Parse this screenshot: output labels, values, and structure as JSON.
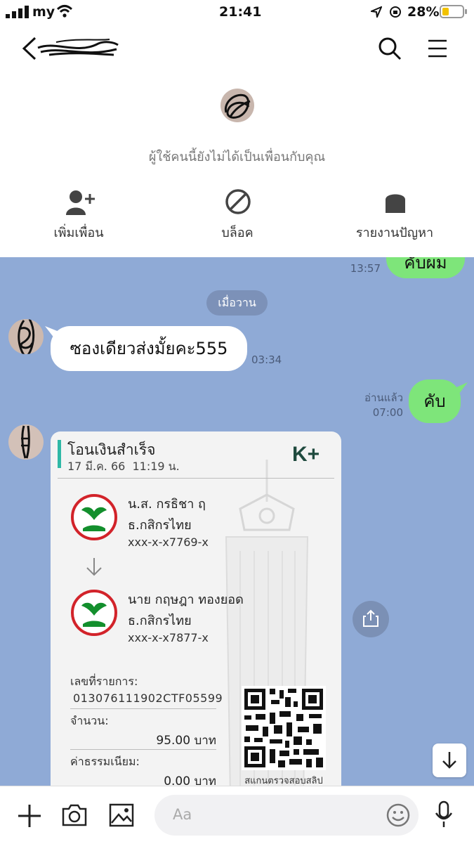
{
  "status_bar": {
    "carrier": "my",
    "time": "21:41",
    "battery": "28%"
  },
  "profile": {
    "not_friend_text": "ผู้ใช้คนนี้ยังไม่ได้เป็นเพื่อนกับคุณ",
    "actions": [
      {
        "label": "เพิ่มเพื่อน",
        "icon": "add-friend-icon"
      },
      {
        "label": "บล็อค",
        "icon": "block-icon"
      },
      {
        "label": "รายงานปัญหา",
        "icon": "report-icon"
      }
    ]
  },
  "chat": {
    "top_partial_message": {
      "text": "คับผม",
      "time": "13:57"
    },
    "date_chip": "เมื่อวาน",
    "messages": [
      {
        "direction": "in",
        "text": "ซองเดียวส่งมั้ยคะ555",
        "time": "03:34"
      },
      {
        "direction": "out",
        "text": "คับ",
        "read": "อ่านแล้ว",
        "time": "07:00"
      }
    ],
    "slip": {
      "title": "โอนเงินสำเร็จ",
      "datetime": "17 มี.ค. 66  11:19 น.",
      "brand": "K+",
      "sender": {
        "name": "น.ส. กรธิชา ฤ",
        "bank": "ธ.กสิกรไทย",
        "account": "xxx-x-x7769-x"
      },
      "receiver": {
        "name": "นาย กฤษฎา ทองยอด",
        "bank": "ธ.กสิกรไทย",
        "account": "xxx-x-x7877-x"
      },
      "ref_label": "เลขที่รายการ:",
      "ref_value": "013076111902CTF05599",
      "amount_label": "จำนวน:",
      "amount_value": "95.00 บาท",
      "fee_label": "ค่าธรรมเนียม:",
      "fee_value": "0.00 บาท",
      "qr_caption": "สแกนตรวจสอบสลิป"
    }
  },
  "input": {
    "placeholder": "Aa"
  },
  "colors": {
    "chat_bg": "#8faad6",
    "bubble_out": "#7ee57a",
    "kbank_green": "#138f2d",
    "kbank_red": "#d2232a"
  }
}
